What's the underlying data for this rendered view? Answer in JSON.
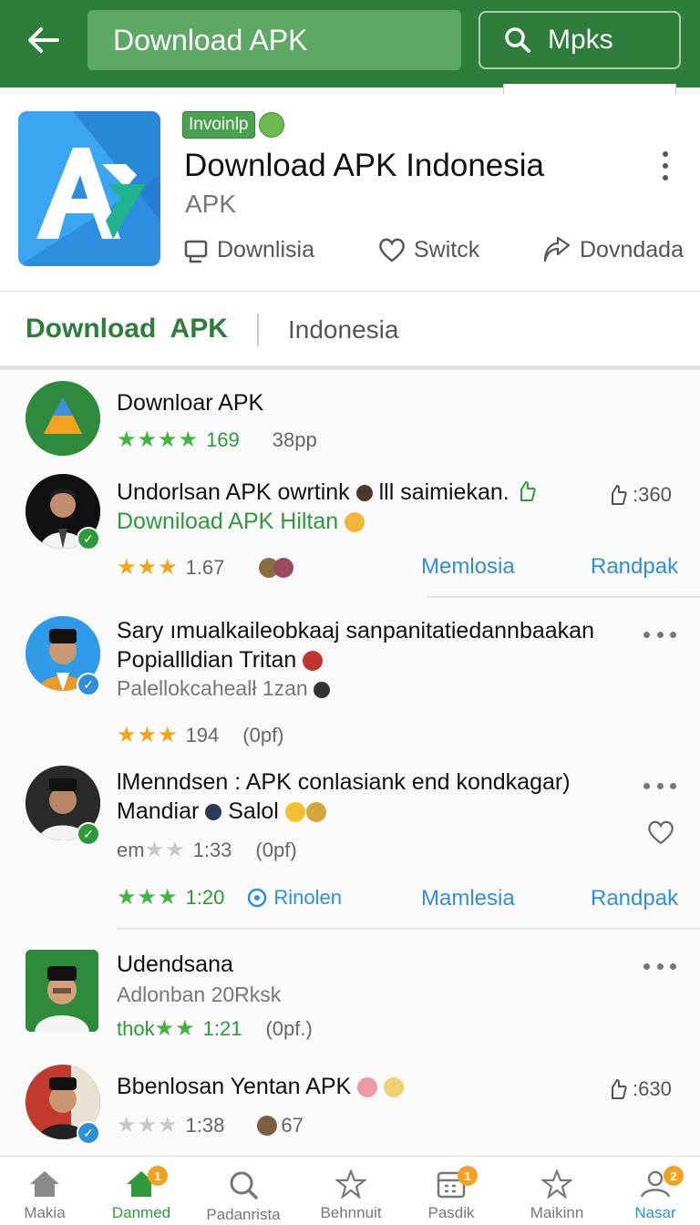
{
  "topbar": {
    "title": "Download APK",
    "search_label": "Mpks"
  },
  "app": {
    "badge": "Invoinlp",
    "name": "Download APK Indonesia",
    "type": "APK",
    "actions": [
      {
        "label": "Downlisia",
        "icon": "download-box-icon"
      },
      {
        "label": "Switck",
        "icon": "heart-icon"
      },
      {
        "label": "Dovndada",
        "icon": "share-icon"
      }
    ]
  },
  "tabs": {
    "primary": "Download APK",
    "secondary": "Indonesia"
  },
  "list": [
    {
      "line1": "Downloar APK",
      "rating": "169",
      "extra": "38pp",
      "stars": "★★★★"
    },
    {
      "line1": "Undorlsan APK owrtink",
      "line1_tail": "lll saimiekan.",
      "line2": "Downiload  APK Hiltan",
      "rating": "1.67",
      "stars": "★★★",
      "count": ":360",
      "link1": "Memlosia",
      "link2": "Randpak"
    },
    {
      "line1": "Sary ımualkaileobkaaj  sanpanitatiedannbaakan",
      "line2": "Popiallldian Tritan",
      "line3": "Palellokcahealł 1zan",
      "rating": "194",
      "extra": "(0pf)",
      "stars": "★★★"
    },
    {
      "line1": "lMenndsen : APK conlasiank  end kondkagar)",
      "line2": "Mandiar",
      "line2_tail": "Salol",
      "meta_prefix": "em",
      "rating": "1:33",
      "extra": "(0pf)",
      "rating2": "1:20",
      "action": "Rinolen",
      "link1": "Mamlesia",
      "link2": "Randpak",
      "stars": "★★",
      "stars2": "★★★"
    },
    {
      "line1": "Udendsana",
      "line2": "Adlonban 20Rksk",
      "meta_prefix": "thok",
      "rating": "1:21",
      "extra": "(0pf.)",
      "stars": "★★"
    },
    {
      "line1": "Bbenlosan Yentan APK",
      "rating": "1:38",
      "extra": "67",
      "count": ":630",
      "stars": "★★★"
    }
  ],
  "bottom_nav": [
    {
      "label": "Makia",
      "icon": "home-icon"
    },
    {
      "label": "Danmed",
      "icon": "home-icon",
      "badge": "1"
    },
    {
      "label": "Padanrista",
      "icon": "search-icon"
    },
    {
      "label": "Behnnuit",
      "icon": "star-icon"
    },
    {
      "label": "Pasdik",
      "icon": "calendar-icon",
      "badge": "1"
    },
    {
      "label": "Maikinn",
      "icon": "star-icon"
    },
    {
      "label": "Nasar",
      "icon": "person-icon",
      "badge": "2"
    }
  ],
  "colors": {
    "primary_green": "#2e7d3a",
    "link_blue": "#2f8fd8",
    "star_orange": "#f2a516",
    "star_green": "#3fb542"
  }
}
